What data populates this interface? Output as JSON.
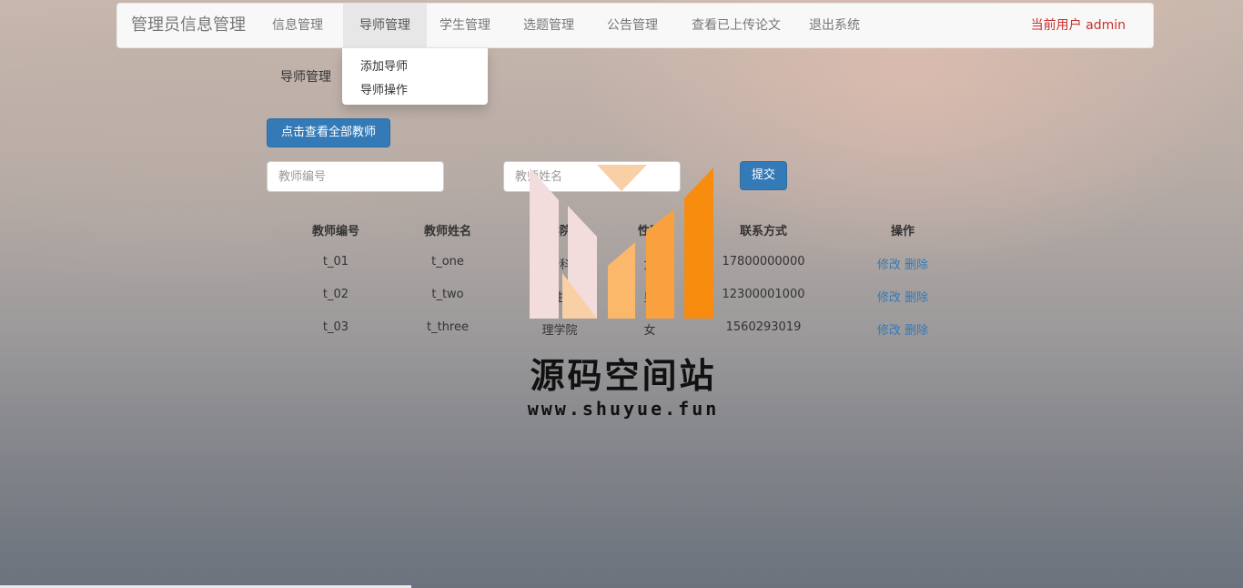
{
  "navbar": {
    "brand": "管理员信息管理",
    "items": [
      {
        "label": "信息管理"
      },
      {
        "label": "导师管理"
      },
      {
        "label": "学生管理"
      },
      {
        "label": "选题管理"
      },
      {
        "label": "公告管理"
      },
      {
        "label": "查看已上传论文"
      },
      {
        "label": "退出系统"
      }
    ],
    "current_user": "当前用户 admin"
  },
  "dropdown": {
    "items": [
      {
        "label": "添加导师"
      },
      {
        "label": "导师操作"
      }
    ]
  },
  "page": {
    "section_title": "导师管理",
    "view_all_button": "点击查看全部教师",
    "search": {
      "id_placeholder": "教师编号",
      "name_placeholder": "教师姓名",
      "submit_label": "提交"
    }
  },
  "table": {
    "headers": [
      "教师编号",
      "教师姓名",
      "学院",
      "性别",
      "联系方式",
      "操作"
    ],
    "rows": [
      {
        "id": "t_01",
        "name": "t_one",
        "college": "计科",
        "gender": "女",
        "contact": "17800000000"
      },
      {
        "id": "t_02",
        "name": "t_two",
        "college": "医生院",
        "gender": "男",
        "contact": "12300001000"
      },
      {
        "id": "t_03",
        "name": "t_three",
        "college": "理学院",
        "gender": "女",
        "contact": "1560293019"
      }
    ],
    "edit_label": "修改",
    "delete_label": "删除"
  },
  "watermark": {
    "title": "源码空间站",
    "url": "www.shuyue.fun"
  },
  "colors": {
    "primary": "#337ab7",
    "user_text": "#c9302c",
    "logo_orange": "#f78c0f",
    "logo_light": "#fbb86a",
    "logo_pink": "#f3dcdc"
  }
}
